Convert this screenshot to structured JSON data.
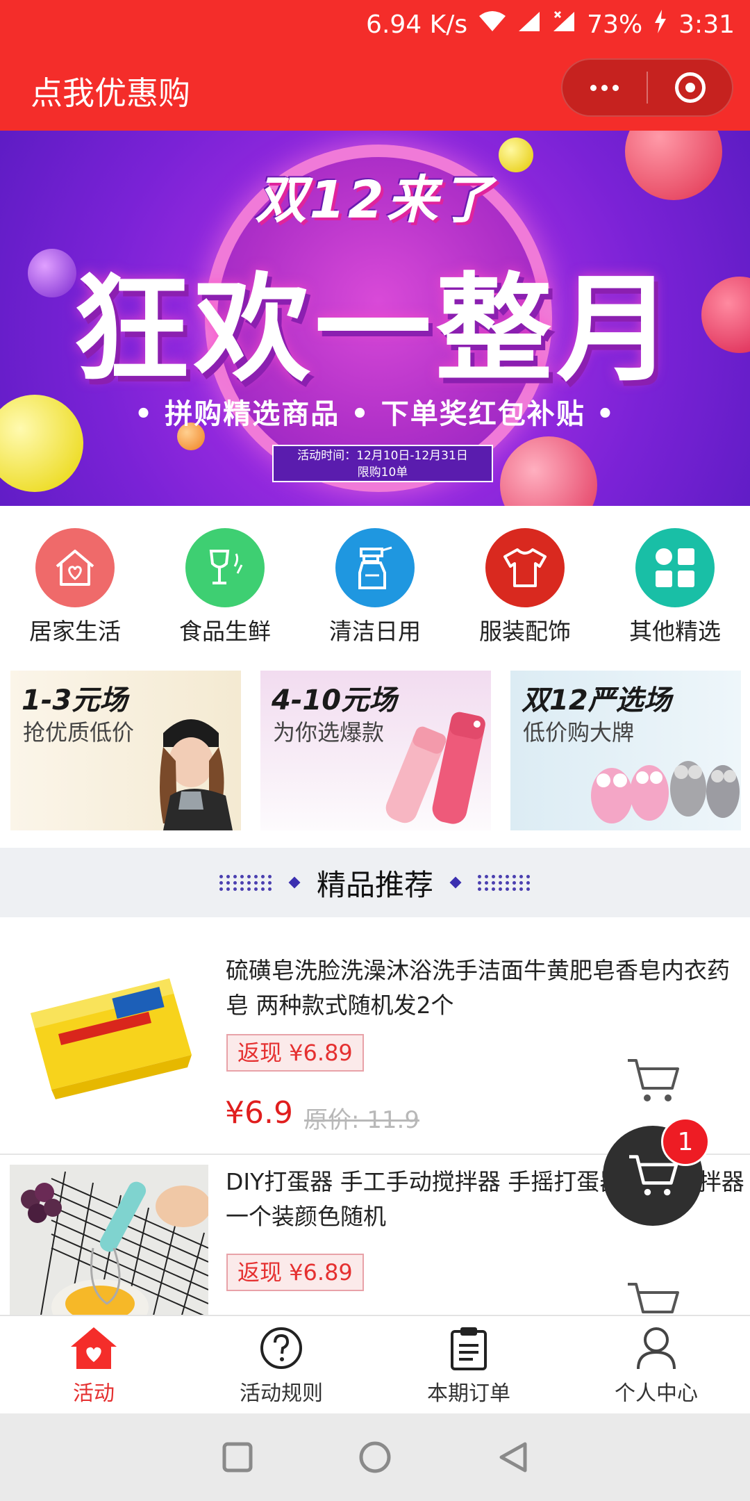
{
  "status_bar": {
    "network_speed": "6.94 K/s",
    "battery": "73%",
    "time": "3:31"
  },
  "header": {
    "title": "点我优惠购"
  },
  "banner": {
    "small_title": "双12来了",
    "main_title": "狂欢一整月",
    "subtitle": "• 拼购精选商品 • 下单奖红包补贴 •",
    "time_line": "活动时间：12月10日-12月31日",
    "limit_line": "限购10单"
  },
  "categories": [
    {
      "label": "居家生活",
      "icon": "home-icon",
      "color": "#ef6a6a"
    },
    {
      "label": "食品生鲜",
      "icon": "wine-icon",
      "color": "#3ecf72"
    },
    {
      "label": "清洁日用",
      "icon": "spray-bottle-icon",
      "color": "#1f97e0"
    },
    {
      "label": "服装配饰",
      "icon": "tshirt-icon",
      "color": "#d9291f"
    },
    {
      "label": "其他精选",
      "icon": "grid-icon",
      "color": "#19bfa6"
    }
  ],
  "promo_tiles": [
    {
      "title": "1-3元场",
      "subtitle": "抢优质低价"
    },
    {
      "title": "4-10元场",
      "subtitle": "为你选爆款"
    },
    {
      "title": "双12严选场",
      "subtitle": "低价购大牌"
    }
  ],
  "section": {
    "title": "精品推荐"
  },
  "products": [
    {
      "name": "硫磺皂洗脸洗澡沐浴洗手洁面牛黄肥皂香皂内衣药皂 两种款式随机发2个",
      "cashback": "返现 ¥6.89",
      "price": "¥6.9",
      "original": "原价: 11.9"
    },
    {
      "name": "DIY打蛋器 手工手动搅拌器 手摇打蛋器 果汁搅拌器一个装颜色随机",
      "cashback": "返现 ¥6.89"
    }
  ],
  "cart": {
    "badge": "1"
  },
  "tabs": [
    {
      "label": "活动",
      "icon": "home-heart-icon",
      "active": true
    },
    {
      "label": "活动规则",
      "icon": "question-icon",
      "active": false
    },
    {
      "label": "本期订单",
      "icon": "clipboard-icon",
      "active": false
    },
    {
      "label": "个人中心",
      "icon": "user-icon",
      "active": false
    }
  ],
  "accent_color": "#f42d2a"
}
